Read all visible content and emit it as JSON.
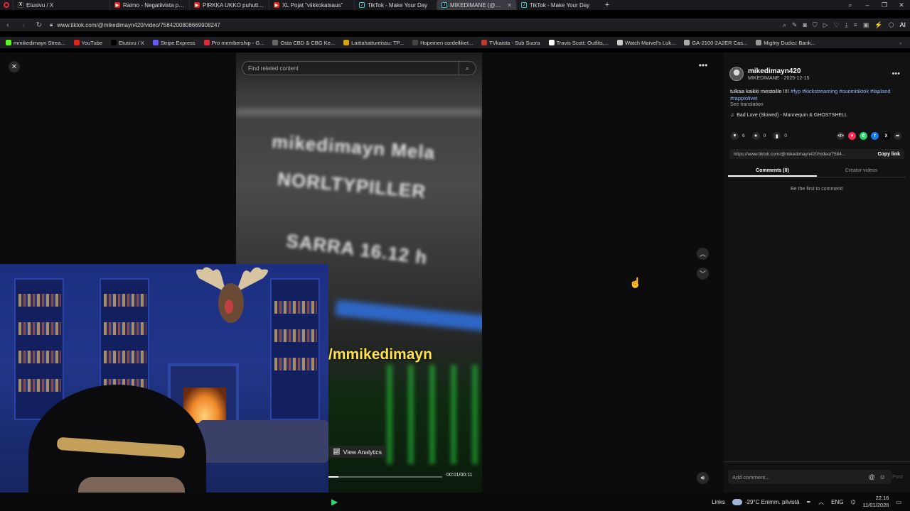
{
  "browser": {
    "tabs": [
      {
        "label": "Etusivu / X",
        "icon": "x-icon",
        "active": false
      },
      {
        "label": "Raimo - Negatiivista palau",
        "icon": "youtube-icon",
        "active": false
      },
      {
        "label": "PIRKKA UKKO puhuttelun",
        "icon": "youtube-icon",
        "active": false
      },
      {
        "label": "XL Pojat \"viikkokatsaus\"",
        "icon": "youtube-icon",
        "active": false
      },
      {
        "label": "TikTok - Make Your Day",
        "icon": "tiktok-icon",
        "active": false
      },
      {
        "label": "MIKEDIMANE (@mike",
        "icon": "tiktok-icon",
        "active": true
      },
      {
        "label": "TikTok - Make Your Day",
        "icon": "tiktok-icon",
        "active": false
      }
    ],
    "new_tab": "+",
    "url": "www.tiktok.com/@mikedimayn420/video/7584200808669908247",
    "ai_label": "AI",
    "bookmarks": [
      {
        "label": "mmikedimayn Strea...",
        "color": "#53fc18"
      },
      {
        "label": "YouTube",
        "color": "#e62117"
      },
      {
        "label": "Etusivu / X",
        "color": "#000000"
      },
      {
        "label": "Stripe Express",
        "color": "#635bff"
      },
      {
        "label": "Pro membership - G...",
        "color": "#e6243a"
      },
      {
        "label": "Osta CBD & CBG Ke...",
        "color": "#666666"
      },
      {
        "label": "Laittahattureissu: TP...",
        "color": "#d8a400"
      },
      {
        "label": "Hopeinen cordelliket...",
        "color": "#444444"
      },
      {
        "label": "TVkaista - Sub Suora",
        "color": "#c0392b"
      },
      {
        "label": "Travis Scott: Outfits,...",
        "color": "#ffffff"
      },
      {
        "label": "Watch Marvel's Luk...",
        "color": "#cccccc"
      },
      {
        "label": "GA-2100-2A2ER Cas...",
        "color": "#aaaaaa"
      },
      {
        "label": "Mighty Ducks: Bank...",
        "color": "#999999"
      }
    ]
  },
  "video": {
    "search_placeholder": "Find related content",
    "overlay_lines": [
      "mikedimayn Mela",
      "NORLTYPILLER",
      "SARRA 16.12 h"
    ],
    "handle_text": "/mmikedimayn",
    "analytics_label": "View Analytics",
    "timecode": "00:01/00:11",
    "progress": 0.09
  },
  "post": {
    "username": "mikedimayn420",
    "display_and_date": "MIKEDIMANE · 2025-12-15",
    "caption_text": "tulkaa kaikki mestoille !!!!",
    "hashtags": "#fyp #kickstreaming #suomitiktok #lapland #rappiolivet",
    "see_translation": "See translation",
    "music": "Bad Love (Slowed) - Mannequin & GHOSTSHELL",
    "likes": "6",
    "comments_count": "0",
    "saves": "0",
    "link": "https://www.tiktok.com/@mikedimayn420/video/7584...",
    "copy_link": "Copy link",
    "tab_comments": "Comments (0)",
    "tab_creator": "Creator videos",
    "empty_text": "Be the first to comment!",
    "comment_placeholder": "Add comment...",
    "post_label": "Post"
  },
  "taskbar": {
    "links": "Links",
    "weather": "-29°C  Enimm. pilvistä",
    "lang": "ENG",
    "time": "22.16",
    "date": "11/01/2026"
  }
}
